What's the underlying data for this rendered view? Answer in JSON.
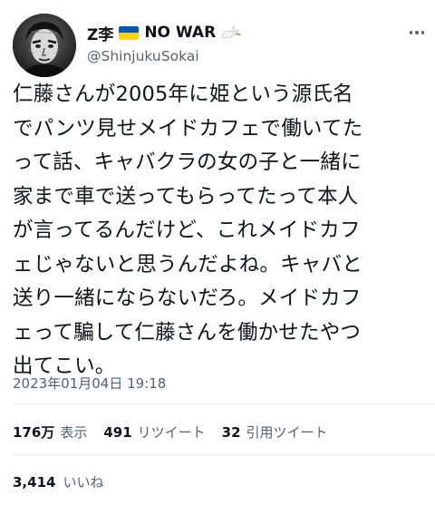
{
  "colors": {
    "text_primary": "#0f1419",
    "text_secondary": "#536471",
    "flag_blue": "#0057b7",
    "flag_yellow": "#ffd700",
    "divider": "#eff3f4"
  },
  "author": {
    "display_name_prefix": "Z李",
    "display_name_suffix": "NO WAR",
    "handle": "@ShinjukuSokai",
    "avatar_icon": "avatar-portrait",
    "flag_icon": "ukraine-flag",
    "dove_icon": "peace-dove"
  },
  "tweet": {
    "lines": [
      "仁藤さんが2005年に姫という源氏名",
      "でパンツ見せメイドカフェで働いてた",
      "って話、キャバクラの女の子と一緒に",
      "家まで車で送ってもらってたって本人",
      "が言ってるんだけど、これメイドカフ",
      "ェじゃないと思うんだよね。キャバと",
      "送り一緒にならないだろ。メイドカフ",
      "ェって騙して仁藤さんを働かせたやつ",
      "出てこい。"
    ],
    "timestamp": "2023年01月04日 19:18"
  },
  "stats": {
    "views": {
      "count": "176万",
      "label": "表示"
    },
    "retweets": {
      "count": "491",
      "label": "リツイート"
    },
    "quotes": {
      "count": "32",
      "label": "引用ツイート"
    },
    "likes": {
      "count": "3,414",
      "label": "いいね"
    }
  }
}
